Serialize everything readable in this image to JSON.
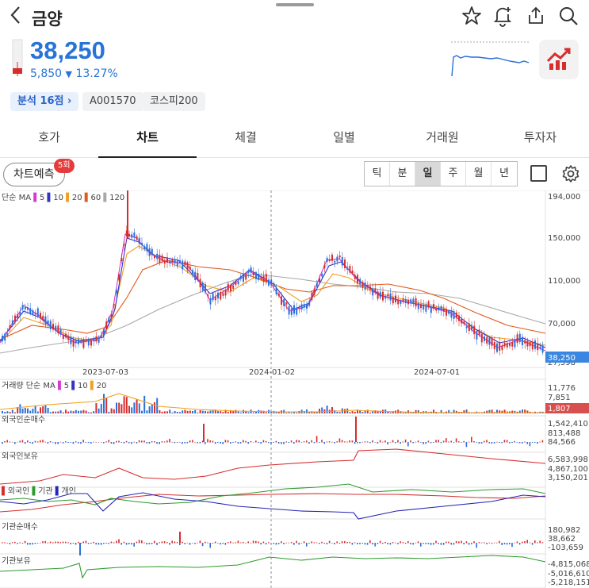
{
  "header": {
    "title": "금양",
    "back_icon": "chevron-left-icon"
  },
  "quote": {
    "price": "38,250",
    "change": "5,850",
    "change_arrow": "▼",
    "change_pct": "13.27%",
    "color": "#2773d8"
  },
  "chips": {
    "analysis": "분석 16점",
    "code": "A001570",
    "index": "코스피200"
  },
  "tabs": [
    "호가",
    "차트",
    "체결",
    "일별",
    "거래원",
    "투자자"
  ],
  "active_tab": "차트",
  "forecast": {
    "label": "차트예측",
    "badge": "5회"
  },
  "periods": [
    "틱",
    "분",
    "일",
    "주",
    "월",
    "년"
  ],
  "active_period": "일",
  "chart": {
    "main_legend": [
      "단순 MA",
      "5",
      "10",
      "20",
      "60",
      "120"
    ],
    "price_ticks": [
      "194,000",
      "150,000",
      "110,000",
      "70,000",
      "27,598"
    ],
    "current_price_tag": "38,250",
    "date_labels": [
      "2023-07-03",
      "2024-01-02",
      "2024-07-01"
    ],
    "volume_legend": [
      "거래량 단순 MA",
      "5",
      "10",
      "20"
    ],
    "volume_ticks": [
      "11,776",
      "7,851"
    ],
    "volume_tag": "1,807",
    "foreign_net": {
      "title": "외국인순매수",
      "ticks": [
        "1,542,410",
        "813,488",
        "84,566"
      ]
    },
    "foreign_hold": {
      "title": "외국인보유",
      "ticks": [
        "6,583,998",
        "4,867,100",
        "3,150,201"
      ]
    },
    "investor_legend": [
      "외국인",
      "기관",
      "개인"
    ],
    "inst_net": {
      "title": "기관순매수",
      "ticks": [
        "180,982",
        "38,662",
        "-103,659"
      ]
    },
    "inst_hold": {
      "title": "기관보유",
      "ticks": [
        "-4,815,068",
        "-5,016,610",
        "-5,218,151"
      ]
    },
    "colors": {
      "up": "#d62d2d",
      "down": "#2b6fd8",
      "ma5": "#d63bd6",
      "ma10": "#3232c8",
      "ma20": "#f0a020",
      "ma60": "#e05a1e",
      "ma120": "#a8a8a8",
      "foreign": "#d62d2d",
      "inst": "#2e9a2e",
      "individual": "#2525b5"
    }
  }
}
